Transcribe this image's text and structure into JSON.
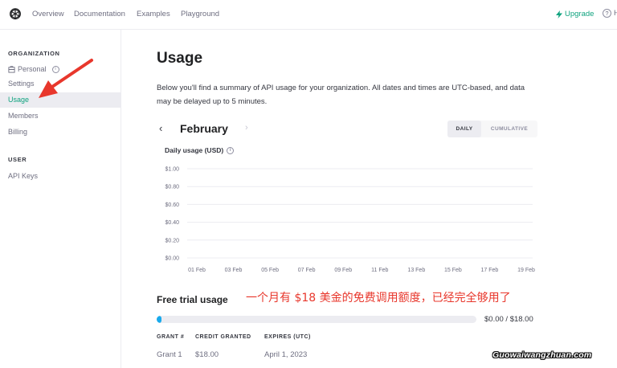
{
  "nav": {
    "overview": "Overview",
    "documentation": "Documentation",
    "examples": "Examples",
    "playground": "Playground",
    "upgrade": "Upgrade",
    "help": "H"
  },
  "sidebar": {
    "org_heading": "ORGANIZATION",
    "items": [
      {
        "label": "Personal"
      },
      {
        "label": "Settings"
      },
      {
        "label": "Usage"
      },
      {
        "label": "Members"
      },
      {
        "label": "Billing"
      }
    ],
    "user_heading": "USER",
    "user_items": [
      {
        "label": "API Keys"
      }
    ]
  },
  "main": {
    "title": "Usage",
    "description": "Below you'll find a summary of API usage for your organization. All dates and times are UTC-based, and data may be delayed up to 5 minutes.",
    "month": "February",
    "toggle_daily": "DAILY",
    "toggle_cumulative": "CUMULATIVE",
    "chart_title": "Daily usage (USD)",
    "free_trial_title": "Free trial usage",
    "annotation": "一个月有 $18 美金的免费调用额度，已经完全够用了",
    "progress_fraction": 0.01,
    "progress_text": "$0.00 / $18.00",
    "grants_headers": [
      "GRANT #",
      "CREDIT GRANTED",
      "EXPIRES (UTC)"
    ],
    "grants_rows": [
      [
        "Grant 1",
        "$18.00",
        "April 1, 2023"
      ]
    ]
  },
  "watermark": "Guowaiwangzhuan.com",
  "colors": {
    "accent": "#10a37f",
    "annotation": "#e8372c",
    "arrow": "#e8372c",
    "progress": "#19aaec"
  },
  "chart_data": {
    "type": "bar",
    "title": "Daily usage (USD)",
    "categories": [
      "01 Feb",
      "03 Feb",
      "05 Feb",
      "07 Feb",
      "09 Feb",
      "11 Feb",
      "13 Feb",
      "15 Feb",
      "17 Feb",
      "19 Feb"
    ],
    "values": [
      0,
      0,
      0,
      0,
      0,
      0,
      0,
      0,
      0,
      0
    ],
    "yticks": [
      "$1.00",
      "$0.80",
      "$0.60",
      "$0.40",
      "$0.20",
      "$0.00"
    ],
    "ylim": [
      0,
      1
    ],
    "grid": true
  }
}
